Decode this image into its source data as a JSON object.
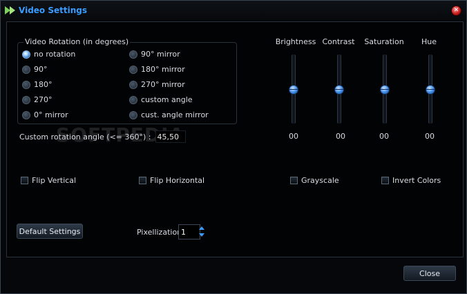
{
  "window": {
    "title": "Video Settings"
  },
  "rotation": {
    "group_title": "Video Rotation (in degrees)",
    "options": [
      {
        "label": "no rotation",
        "selected": true
      },
      {
        "label": "90°",
        "selected": false
      },
      {
        "label": "180°",
        "selected": false
      },
      {
        "label": "270°",
        "selected": false
      },
      {
        "label": "0°  mirror",
        "selected": false
      },
      {
        "label": "90°  mirror",
        "selected": false
      },
      {
        "label": "180° mirror",
        "selected": false
      },
      {
        "label": "270° mirror",
        "selected": false
      },
      {
        "label": "custom angle",
        "selected": false
      },
      {
        "label": "cust. angle mirror",
        "selected": false
      }
    ],
    "custom_label": "Custom rotation angle (<= 360°) :",
    "custom_value": "45,50"
  },
  "sliders": [
    {
      "label": "Brightness",
      "value": "00"
    },
    {
      "label": "Contrast",
      "value": "00"
    },
    {
      "label": "Saturation",
      "value": "00"
    },
    {
      "label": "Hue",
      "value": "00"
    }
  ],
  "checkboxes": {
    "flip_vertical": "Flip Vertical",
    "flip_horizontal": "Flip Horizontal",
    "grayscale": "Grayscale",
    "invert_colors": "Invert Colors"
  },
  "buttons": {
    "default_settings": "Default Settings",
    "close": "Close"
  },
  "pixellization": {
    "label": "Pixellization",
    "value": "1"
  },
  "watermark": "SOFTPEDIA",
  "colors": {
    "title": "#3b9cff",
    "accent": "#3c8ae6",
    "background": "#05070a"
  },
  "icons": {
    "app": "play-arrows-icon",
    "close": "close-icon",
    "spin_up": "chevron-up-icon",
    "spin_down": "chevron-down-icon"
  }
}
